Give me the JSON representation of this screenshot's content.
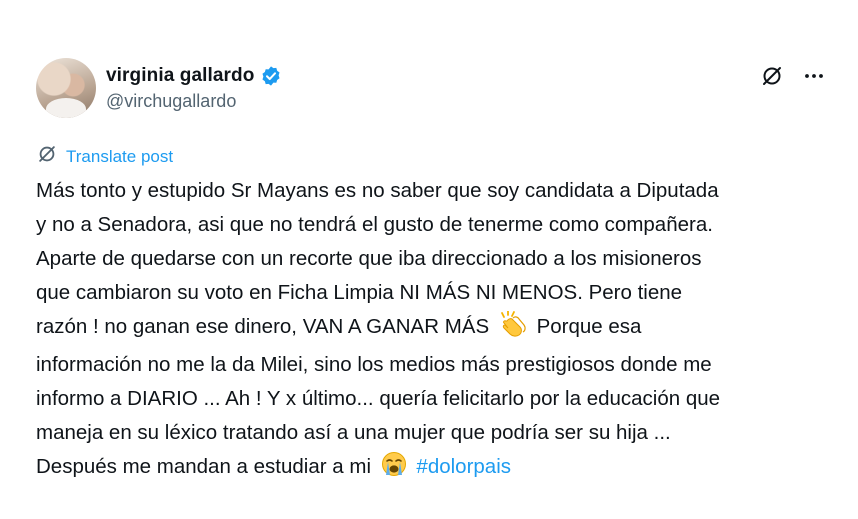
{
  "author": {
    "display_name": "virginia gallardo",
    "handle": "@virchugallardo",
    "verified": true
  },
  "actions": {
    "translate_icon": "translate-icon",
    "more_icon": "more-icon"
  },
  "translate": {
    "label": "Translate post"
  },
  "post": {
    "lines": [
      "Más tonto y estupido Sr Mayans es no saber que soy candidata a Diputada",
      "y no a Senadora, asi que no tendrá el gusto de tenerme como compañera.",
      "Aparte de quedarse con un recorte que iba direccionado a los misioneros",
      "que cambiaron su voto en Ficha Limpia NI MÁS NI MENOS. Pero tiene",
      "razón ! no ganan ese dinero, VAN A GANAR MÁS",
      "información no me la da Milei, sino los medios más prestigiosos donde me",
      "informo a DIARIO ... Ah ! Y x último... quería felicitarlo por la educación que",
      "maneja en su léxico tratando así a una mujer que podría ser su hija ...",
      "Después me mandan a estudiar a mi"
    ],
    "line5_after_emoji": "Porque esa",
    "hashtag": "#dolorpais",
    "emoji_clap": "clapping-hands-emoji",
    "emoji_cry": "loudly-crying-face-emoji"
  },
  "colors": {
    "accent": "#1d9bf0",
    "secondary_text": "#536471",
    "primary_text": "#0f1419"
  }
}
